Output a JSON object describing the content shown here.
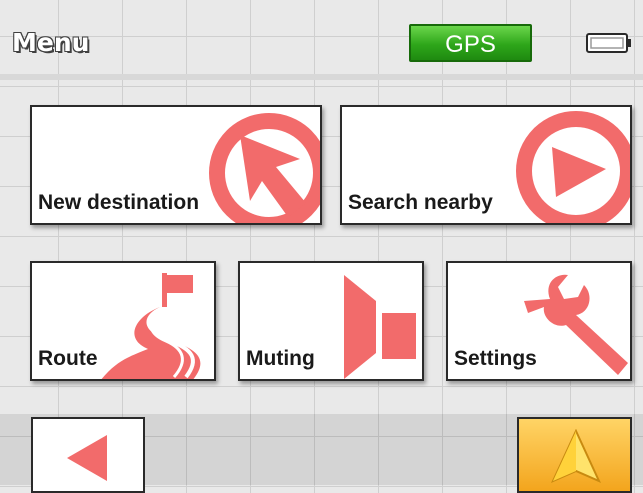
{
  "header": {
    "title": "Menu",
    "gps_label": "GPS",
    "battery_icon": "battery-icon"
  },
  "tiles": [
    {
      "id": "new-destination",
      "label": "New destination",
      "icon": "new-destination-arrow-icon"
    },
    {
      "id": "search-nearby",
      "label": "Search nearby",
      "icon": "search-nearby-arrow-icon"
    },
    {
      "id": "route",
      "label": "Route",
      "icon": "route-flag-icon"
    },
    {
      "id": "muting",
      "label": "Muting",
      "icon": "speaker-icon"
    },
    {
      "id": "settings",
      "label": "Settings",
      "icon": "wrench-icon"
    }
  ],
  "footer": {
    "back_icon": "back-arrow-icon",
    "navigation_icon": "navigation-arrow-icon"
  },
  "colors": {
    "icon_accent": "#f26b6b",
    "gps_green": "#2ea61a",
    "nav_button_orange": "#f3a51d"
  }
}
